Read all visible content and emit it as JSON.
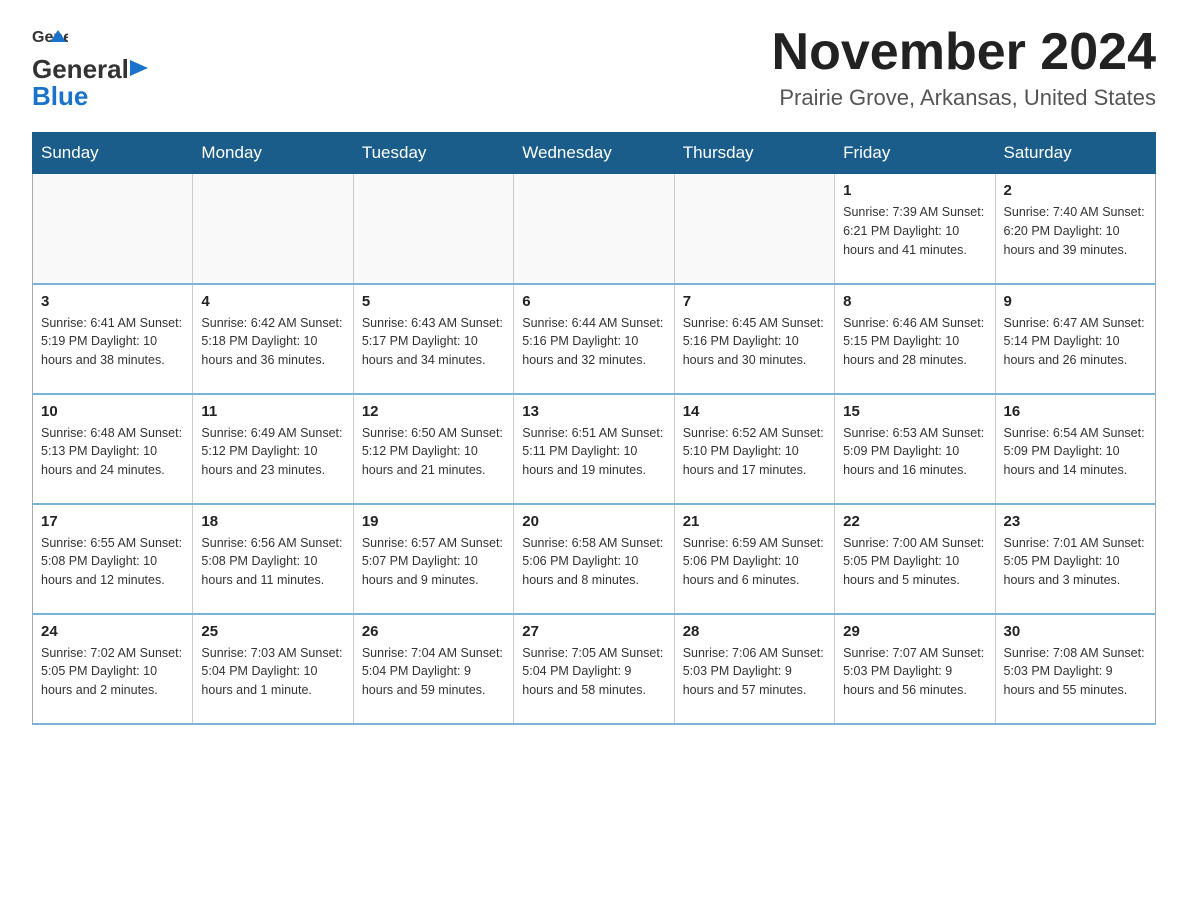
{
  "header": {
    "logo": {
      "text_general": "General",
      "text_blue": "Blue",
      "aria": "GeneralBlue logo"
    },
    "month_title": "November 2024",
    "location": "Prairie Grove, Arkansas, United States"
  },
  "days_of_week": [
    "Sunday",
    "Monday",
    "Tuesday",
    "Wednesday",
    "Thursday",
    "Friday",
    "Saturday"
  ],
  "weeks": [
    [
      {
        "day": "",
        "info": ""
      },
      {
        "day": "",
        "info": ""
      },
      {
        "day": "",
        "info": ""
      },
      {
        "day": "",
        "info": ""
      },
      {
        "day": "",
        "info": ""
      },
      {
        "day": "1",
        "info": "Sunrise: 7:39 AM\nSunset: 6:21 PM\nDaylight: 10 hours and 41 minutes."
      },
      {
        "day": "2",
        "info": "Sunrise: 7:40 AM\nSunset: 6:20 PM\nDaylight: 10 hours and 39 minutes."
      }
    ],
    [
      {
        "day": "3",
        "info": "Sunrise: 6:41 AM\nSunset: 5:19 PM\nDaylight: 10 hours and 38 minutes."
      },
      {
        "day": "4",
        "info": "Sunrise: 6:42 AM\nSunset: 5:18 PM\nDaylight: 10 hours and 36 minutes."
      },
      {
        "day": "5",
        "info": "Sunrise: 6:43 AM\nSunset: 5:17 PM\nDaylight: 10 hours and 34 minutes."
      },
      {
        "day": "6",
        "info": "Sunrise: 6:44 AM\nSunset: 5:16 PM\nDaylight: 10 hours and 32 minutes."
      },
      {
        "day": "7",
        "info": "Sunrise: 6:45 AM\nSunset: 5:16 PM\nDaylight: 10 hours and 30 minutes."
      },
      {
        "day": "8",
        "info": "Sunrise: 6:46 AM\nSunset: 5:15 PM\nDaylight: 10 hours and 28 minutes."
      },
      {
        "day": "9",
        "info": "Sunrise: 6:47 AM\nSunset: 5:14 PM\nDaylight: 10 hours and 26 minutes."
      }
    ],
    [
      {
        "day": "10",
        "info": "Sunrise: 6:48 AM\nSunset: 5:13 PM\nDaylight: 10 hours and 24 minutes."
      },
      {
        "day": "11",
        "info": "Sunrise: 6:49 AM\nSunset: 5:12 PM\nDaylight: 10 hours and 23 minutes."
      },
      {
        "day": "12",
        "info": "Sunrise: 6:50 AM\nSunset: 5:12 PM\nDaylight: 10 hours and 21 minutes."
      },
      {
        "day": "13",
        "info": "Sunrise: 6:51 AM\nSunset: 5:11 PM\nDaylight: 10 hours and 19 minutes."
      },
      {
        "day": "14",
        "info": "Sunrise: 6:52 AM\nSunset: 5:10 PM\nDaylight: 10 hours and 17 minutes."
      },
      {
        "day": "15",
        "info": "Sunrise: 6:53 AM\nSunset: 5:09 PM\nDaylight: 10 hours and 16 minutes."
      },
      {
        "day": "16",
        "info": "Sunrise: 6:54 AM\nSunset: 5:09 PM\nDaylight: 10 hours and 14 minutes."
      }
    ],
    [
      {
        "day": "17",
        "info": "Sunrise: 6:55 AM\nSunset: 5:08 PM\nDaylight: 10 hours and 12 minutes."
      },
      {
        "day": "18",
        "info": "Sunrise: 6:56 AM\nSunset: 5:08 PM\nDaylight: 10 hours and 11 minutes."
      },
      {
        "day": "19",
        "info": "Sunrise: 6:57 AM\nSunset: 5:07 PM\nDaylight: 10 hours and 9 minutes."
      },
      {
        "day": "20",
        "info": "Sunrise: 6:58 AM\nSunset: 5:06 PM\nDaylight: 10 hours and 8 minutes."
      },
      {
        "day": "21",
        "info": "Sunrise: 6:59 AM\nSunset: 5:06 PM\nDaylight: 10 hours and 6 minutes."
      },
      {
        "day": "22",
        "info": "Sunrise: 7:00 AM\nSunset: 5:05 PM\nDaylight: 10 hours and 5 minutes."
      },
      {
        "day": "23",
        "info": "Sunrise: 7:01 AM\nSunset: 5:05 PM\nDaylight: 10 hours and 3 minutes."
      }
    ],
    [
      {
        "day": "24",
        "info": "Sunrise: 7:02 AM\nSunset: 5:05 PM\nDaylight: 10 hours and 2 minutes."
      },
      {
        "day": "25",
        "info": "Sunrise: 7:03 AM\nSunset: 5:04 PM\nDaylight: 10 hours and 1 minute."
      },
      {
        "day": "26",
        "info": "Sunrise: 7:04 AM\nSunset: 5:04 PM\nDaylight: 9 hours and 59 minutes."
      },
      {
        "day": "27",
        "info": "Sunrise: 7:05 AM\nSunset: 5:04 PM\nDaylight: 9 hours and 58 minutes."
      },
      {
        "day": "28",
        "info": "Sunrise: 7:06 AM\nSunset: 5:03 PM\nDaylight: 9 hours and 57 minutes."
      },
      {
        "day": "29",
        "info": "Sunrise: 7:07 AM\nSunset: 5:03 PM\nDaylight: 9 hours and 56 minutes."
      },
      {
        "day": "30",
        "info": "Sunrise: 7:08 AM\nSunset: 5:03 PM\nDaylight: 9 hours and 55 minutes."
      }
    ]
  ]
}
